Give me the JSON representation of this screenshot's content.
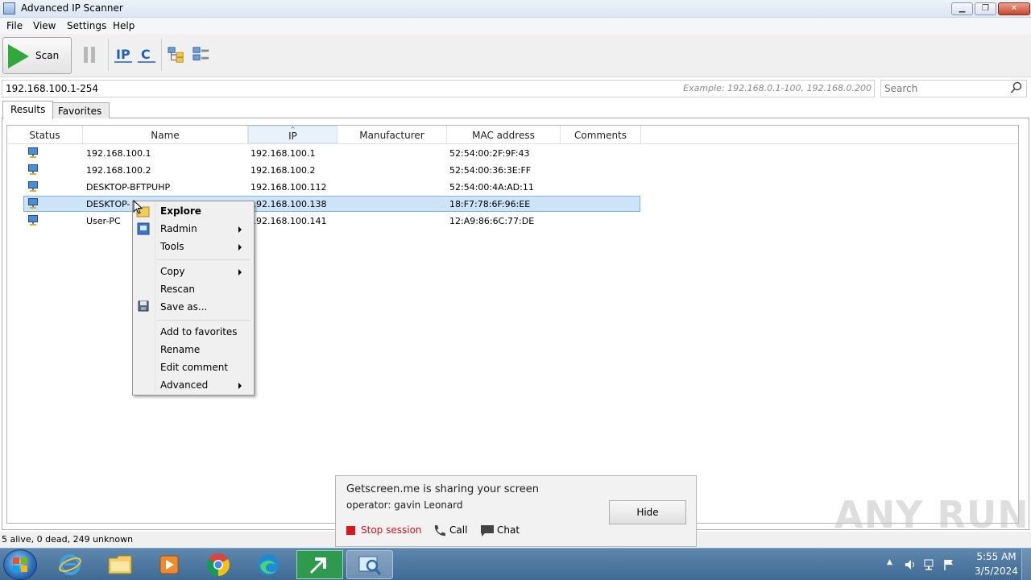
{
  "window": {
    "title": "Advanced IP Scanner",
    "min_label": "▁",
    "max_label": "❐",
    "close_label": "✕"
  },
  "menu": [
    "File",
    "View",
    "Settings",
    "Help"
  ],
  "toolbar": {
    "scan_label": "Scan"
  },
  "address": {
    "range_value": "192.168.100.1-254",
    "example": "Example: 192.168.0.1-100, 192.168.0.200",
    "search_placeholder": "Search"
  },
  "tabs": [
    "Results",
    "Favorites"
  ],
  "columns": [
    "Status",
    "Name",
    "IP",
    "Manufacturer",
    "MAC address",
    "Comments"
  ],
  "rows": [
    {
      "name": "192.168.100.1",
      "ip": "192.168.100.1",
      "manufacturer": "",
      "mac": "52:54:00:2F:9F:43",
      "comments": ""
    },
    {
      "name": "192.168.100.2",
      "ip": "192.168.100.2",
      "manufacturer": "",
      "mac": "52:54:00:36:3E:FF",
      "comments": ""
    },
    {
      "name": "DESKTOP-BFTPUHP",
      "ip": "192.168.100.112",
      "manufacturer": "",
      "mac": "52:54:00:4A:AD:11",
      "comments": ""
    },
    {
      "name": "DESKTOP-",
      "ip": "192.168.100.138",
      "manufacturer": "",
      "mac": "18:F7:78:6F:96:EE",
      "comments": ""
    },
    {
      "name": "User-PC",
      "ip": "192.168.100.141",
      "manufacturer": "",
      "mac": "12:A9:86:6C:77:DE",
      "comments": ""
    }
  ],
  "context_menu": {
    "explore": "Explore",
    "radmin": "Radmin",
    "tools": "Tools",
    "copy": "Copy",
    "rescan": "Rescan",
    "save_as": "Save as...",
    "add_favorites": "Add to favorites",
    "rename": "Rename",
    "edit_comment": "Edit comment",
    "advanced": "Advanced"
  },
  "status": "5 alive, 0 dead, 249 unknown",
  "share_popup": {
    "title": "Getscreen.me is sharing your screen",
    "operator": "operator: gavin Leonard",
    "hide": "Hide",
    "stop": "Stop session",
    "call": "Call",
    "chat": "Chat"
  },
  "watermark": "ANY RUN",
  "taskbar": {
    "time": "5:55 AM",
    "date": "3/5/2024"
  },
  "colors": {
    "accent": "#cce4f7",
    "scan_green": "#2faa3a",
    "stop_red": "#e0141d"
  }
}
